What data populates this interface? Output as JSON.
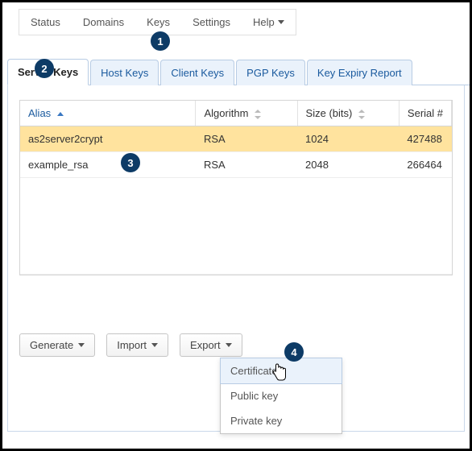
{
  "topmenu": {
    "items": [
      "Status",
      "Domains",
      "Keys",
      "Settings",
      "Help"
    ]
  },
  "badges": {
    "b1": "1",
    "b2": "2",
    "b3": "3",
    "b4": "4"
  },
  "tabs": [
    {
      "label": "Server Keys"
    },
    {
      "label": "Host Keys"
    },
    {
      "label": "Client Keys"
    },
    {
      "label": "PGP Keys"
    },
    {
      "label": "Key Expiry Report"
    }
  ],
  "table": {
    "headers": {
      "alias": "Alias",
      "algorithm": "Algorithm",
      "size": "Size (bits)",
      "serial": "Serial #"
    },
    "rows": [
      {
        "alias": "as2server2crypt",
        "algorithm": "RSA",
        "size": "1024",
        "serial": "427488"
      },
      {
        "alias": "example_rsa",
        "algorithm": "RSA",
        "size": "2048",
        "serial": "266464"
      }
    ]
  },
  "buttons": {
    "generate": "Generate",
    "import": "Import",
    "export": "Export"
  },
  "exportMenu": {
    "certificate": "Certificate",
    "publicKey": "Public key",
    "privateKey": "Private key"
  }
}
